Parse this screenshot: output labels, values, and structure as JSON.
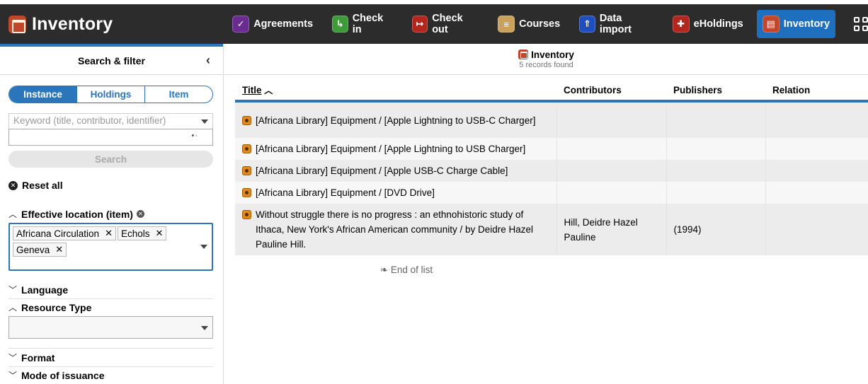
{
  "app": {
    "title": "Inventory"
  },
  "nav": [
    {
      "label": "Agreements",
      "icon": "agreements-icon",
      "color": "#6b2c91",
      "glyph": "✓"
    },
    {
      "label": "Check in",
      "icon": "check-in-icon",
      "color": "#3f9a3a",
      "glyph": "↳"
    },
    {
      "label": "Check out",
      "icon": "check-out-icon",
      "color": "#b3261e",
      "glyph": "↦"
    },
    {
      "label": "Courses",
      "icon": "courses-icon",
      "color": "#c9a15a",
      "glyph": "≡"
    },
    {
      "label": "Data import",
      "icon": "data-import-icon",
      "color": "#1f4fbf",
      "glyph": "⇑"
    },
    {
      "label": "eHoldings",
      "icon": "eholdings-icon",
      "color": "#b3261e",
      "glyph": "✚"
    },
    {
      "label": "Inventory",
      "icon": "inventory-icon",
      "color": "#c0472b",
      "glyph": "▤",
      "active": true
    }
  ],
  "filter_pane": {
    "title": "Search & filter",
    "segments": [
      "Instance",
      "Holdings",
      "Item"
    ],
    "keyword_placeholder": "Keyword (title, contributor, identifier)",
    "search_label": "Search",
    "reset_label": "Reset all",
    "effective_location": {
      "label": "Effective location (item)",
      "chips": [
        "Africana Circulation",
        "Echols",
        "Geneva"
      ]
    },
    "language_label": "Language",
    "resource_type_label": "Resource Type",
    "format_label": "Format",
    "mode_label": "Mode of issuance"
  },
  "results": {
    "title": "Inventory",
    "count": "5 records found",
    "columns": [
      "Title",
      "Contributors",
      "Publishers",
      "Relation"
    ],
    "rows": [
      {
        "title": "[Africana Library] Equipment / [Apple Lightning to USB-C Charger]",
        "contributors": "",
        "publishers": "",
        "relation": ""
      },
      {
        "title": "[Africana Library] Equipment / [Apple Lightning to USB Charger]",
        "contributors": "",
        "publishers": "",
        "relation": ""
      },
      {
        "title": "[Africana Library] Equipment / [Apple USB-C Charge Cable]",
        "contributors": "",
        "publishers": "",
        "relation": ""
      },
      {
        "title": "[Africana Library] Equipment / [DVD Drive]",
        "contributors": "",
        "publishers": "",
        "relation": ""
      },
      {
        "title": "Without struggle there is no progress : an ethnohistoric study of Ithaca, New York's African American community / by Deidre Hazel Pauline Hill.",
        "contributors": "Hill, Deidre Hazel Pauline",
        "publishers": "(1994)",
        "relation": ""
      }
    ],
    "end_label": "❧ End of list"
  }
}
